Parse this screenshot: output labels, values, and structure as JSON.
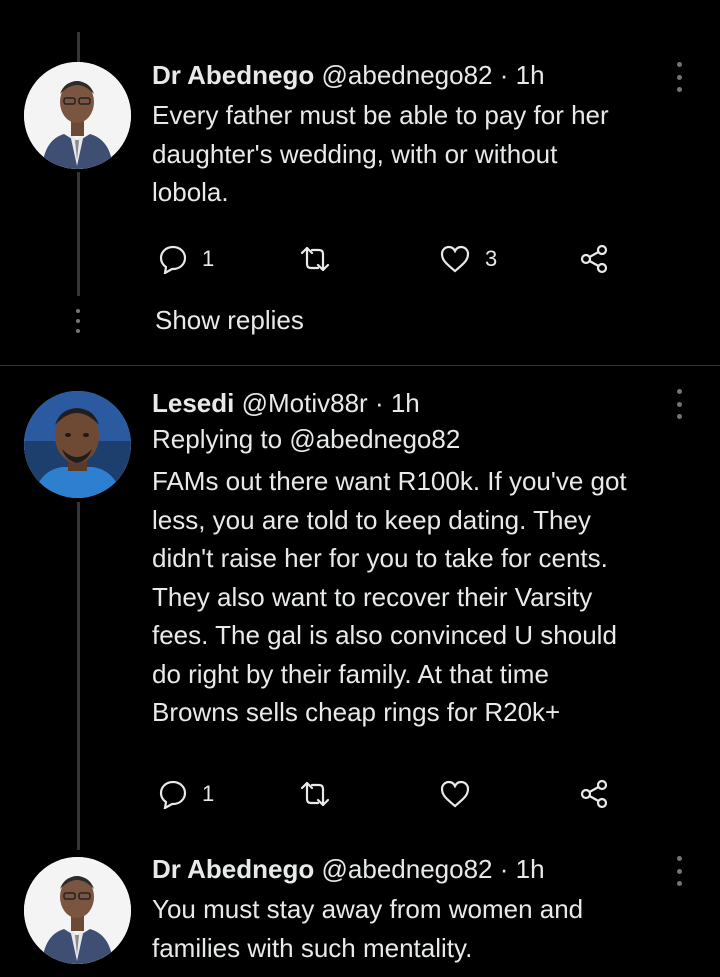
{
  "tweets": [
    {
      "name": "Dr Abednego",
      "handle": "@abednego82",
      "separator": "·",
      "time": "1h",
      "avatar": "man-in-suit-avatar",
      "text_lines": [
        "Every father must be able to pay for her",
        "daughter's wedding, with or without",
        "lobola."
      ],
      "reply_count": "1",
      "like_count": "3"
    },
    {
      "name": "Lesedi",
      "handle": "@Motiv88r",
      "separator": "·",
      "time": "1h",
      "avatar": "young-man-avatar",
      "replying_to_prefix": "Replying to ",
      "replying_to_handle": "@abednego82",
      "text_lines": [
        "FAMs out there want R100k. If you've got",
        "less, you are told to keep dating. They",
        "didn't raise her for you to take for cents.",
        "They also want to recover their Varsity",
        "fees. The gal is also convinced U should",
        "do right by their family. At that time",
        "Browns sells cheap rings for R20k+"
      ],
      "reply_count": "1",
      "like_count": ""
    },
    {
      "name": "Dr Abednego",
      "handle": "@abednego82",
      "separator": "·",
      "time": "1h",
      "avatar": "man-in-suit-avatar",
      "text_lines": [
        "You must stay away from women and",
        "families with such mentality."
      ]
    }
  ],
  "show_replies_label": "Show replies",
  "colors": {
    "background": "#000000",
    "text": "#e7e9ea",
    "muted": "#71767b",
    "line": "#333639"
  }
}
